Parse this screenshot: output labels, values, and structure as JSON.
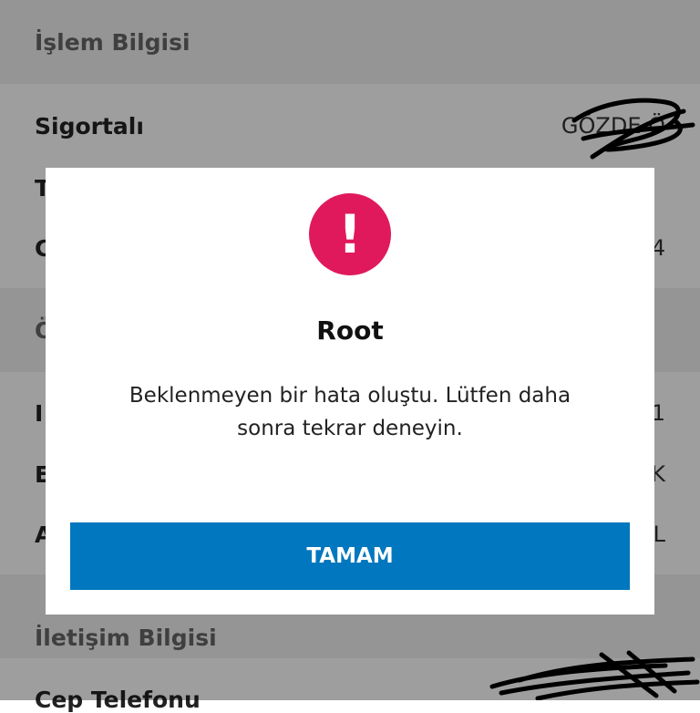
{
  "background": {
    "section1_title": "İşlem Bilgisi",
    "insured_label": "Sigortalı",
    "insured_value": "GÖZDE Ö",
    "row2_label": "T",
    "row3_label": "C",
    "row3_value": "4",
    "section2_title": "Ö",
    "row4_label": "I",
    "row4_value": "1",
    "row5_label": "E",
    "row5_value": "K",
    "row6_label": "A",
    "row6_value": "L",
    "section3_title": "İletişim Bilgisi",
    "mobile_label": "Cep Telefonu"
  },
  "dialog": {
    "icon": "exclamation-icon",
    "icon_glyph": "!",
    "title": "Root",
    "message": "Beklenmeyen bir hata oluştu. Lütfen daha sonra tekrar deneyin.",
    "ok_label": "TAMAM"
  },
  "colors": {
    "alert": "#e0195d",
    "primary_button": "#0077be"
  }
}
